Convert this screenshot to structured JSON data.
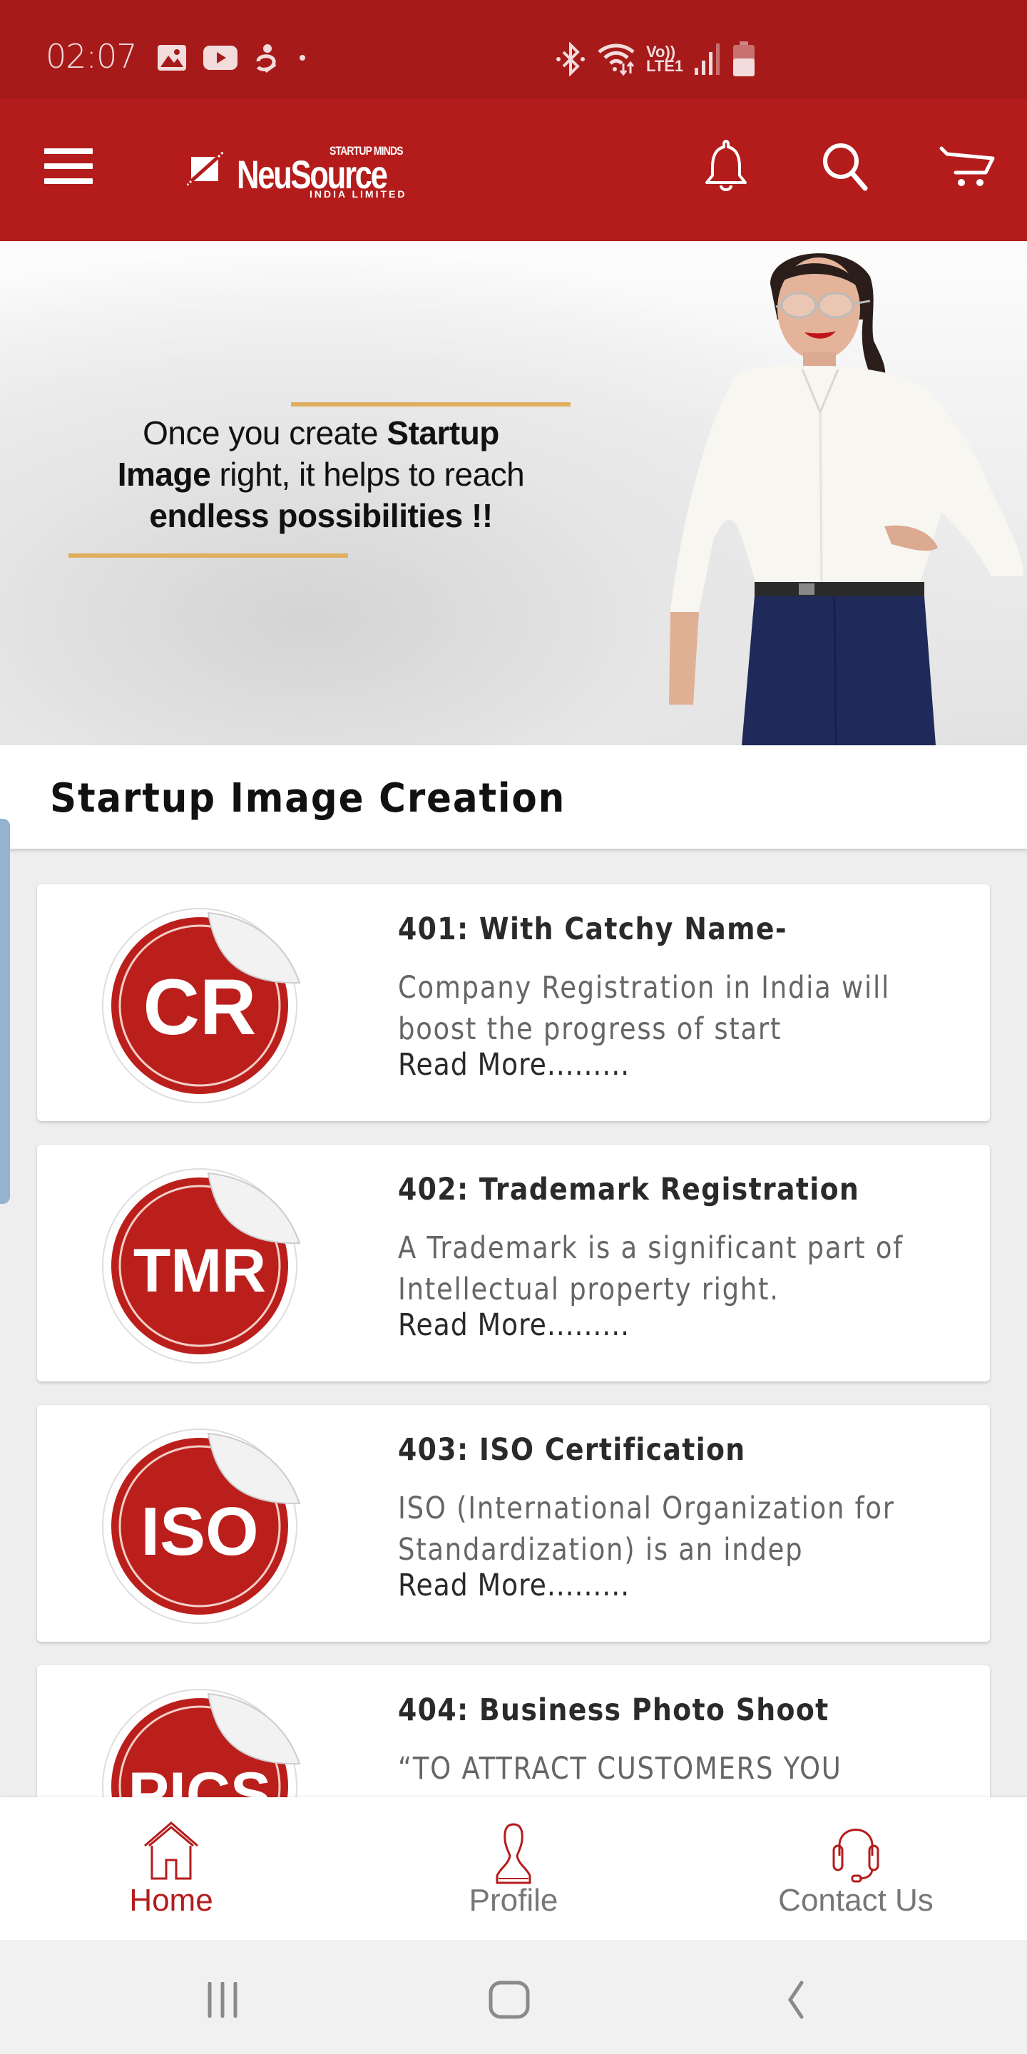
{
  "status_bar": {
    "time": "02:07",
    "left_icons": [
      "gallery-icon",
      "youtube-icon",
      "app-notification-icon",
      "dot-icon"
    ],
    "right_icons": [
      "bluetooth-icon",
      "wifi-icon",
      "volte-icon",
      "signal-icon",
      "battery-icon"
    ],
    "volte_line1": "Vo))",
    "volte_line2": "LTE1"
  },
  "app_bar": {
    "logo_tagline": "STARTUP MINDS",
    "logo_name": "NeuSource",
    "logo_subtitle": "INDIA LIMITED",
    "icons": [
      "menu-icon",
      "bell-icon",
      "search-icon",
      "cart-icon"
    ]
  },
  "banner": {
    "line1_regular": "Once you create ",
    "line1_bold": "Startup",
    "line2_bold": "Image",
    "line2_regular": " right, it helps to reach",
    "line3_bold": "endless possibilities !!",
    "accent_color": "#e0ae5c"
  },
  "section": {
    "title": "Startup Image Creation"
  },
  "cards": [
    {
      "badge": "CR",
      "title": "401: With Catchy Name-",
      "description": "Company Registration in India will boost the progress of start",
      "read_more": "Read More........."
    },
    {
      "badge": "TMR",
      "title": "402: Trademark Registration",
      "description": "A Trademark is a significant part of Intellectual property right.",
      "read_more": "Read More........."
    },
    {
      "badge": "ISO",
      "title": "403: ISO Certification",
      "description": "ISO (International Organization for Standardization) is an indep",
      "read_more": "Read More........."
    },
    {
      "badge": "PICS",
      "title": "404: Business Photo Shoot",
      "description": "“TO ATTRACT CUSTOMERS YOU",
      "read_more": ""
    }
  ],
  "bottom_nav": {
    "items": [
      {
        "label": "Home",
        "icon": "home-icon",
        "active": true
      },
      {
        "label": "Profile",
        "icon": "profile-icon",
        "active": false
      },
      {
        "label": "Contact Us",
        "icon": "headset-icon",
        "active": false
      }
    ]
  },
  "system_nav": {
    "buttons": [
      "recent-apps-icon",
      "home-circle-icon",
      "back-icon"
    ]
  },
  "colors": {
    "status_bar": "#a61a1a",
    "brand_red": "#b41c1c",
    "background": "#eeeeee",
    "badge_red": "#bb1f1c",
    "nav_inactive": "#777777"
  }
}
